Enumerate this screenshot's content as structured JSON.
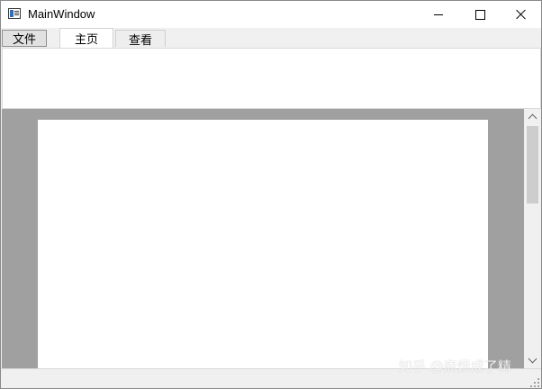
{
  "window": {
    "title": "MainWindow"
  },
  "icons": {
    "app": "app-window-icon",
    "minimize": "minimize-icon",
    "maximize": "maximize-icon",
    "close": "close-icon",
    "scroll_up": "chevron-up-icon",
    "scroll_down": "chevron-down-icon",
    "size_grip": "size-grip-icon"
  },
  "ribbon": {
    "tabs": [
      {
        "label": "文件"
      },
      {
        "label": "主页",
        "active": true
      },
      {
        "label": "查看"
      }
    ]
  },
  "watermark": {
    "text": "知乎 @麻烦成了精"
  },
  "colors": {
    "workspace_bg": "#a0a0a0",
    "page_bg": "#ffffff",
    "chrome_bg": "#f0f0f0"
  }
}
